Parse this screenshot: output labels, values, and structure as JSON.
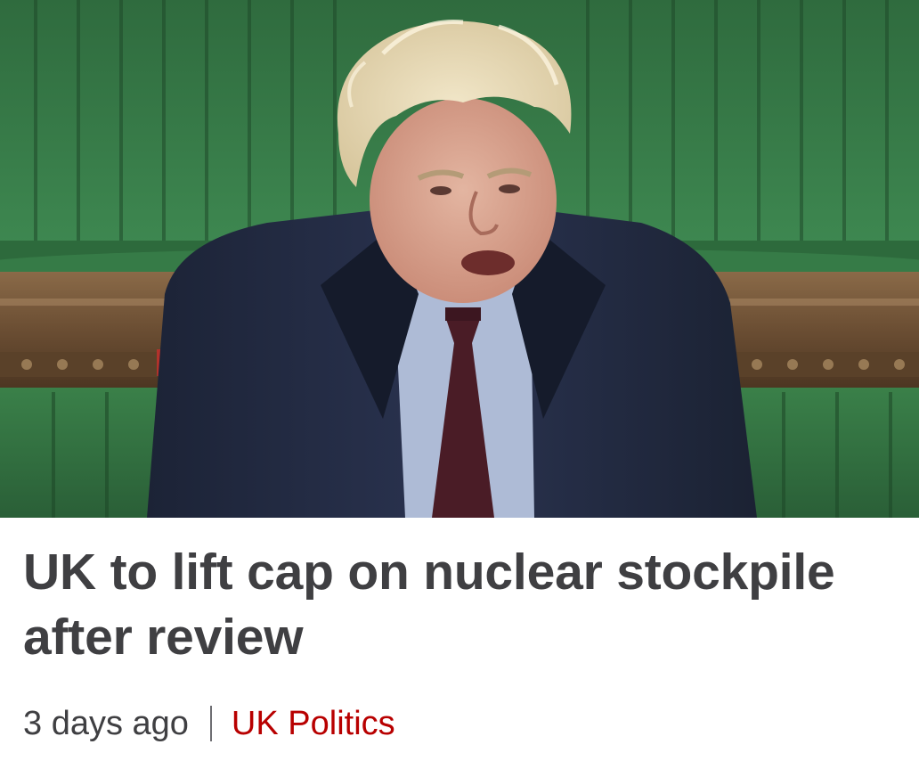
{
  "article": {
    "image_alt": "Boris Johnson speaking in the House of Commons",
    "headline": "UK to lift cap on nuclear stockpile after review",
    "timestamp": "3 days ago",
    "topic": "UK Politics"
  },
  "colors": {
    "headline_text": "#3f3f42",
    "meta_text": "#3f3f42",
    "topic_link": "#b80000",
    "divider": "#6e6e73",
    "background": "#ffffff"
  }
}
